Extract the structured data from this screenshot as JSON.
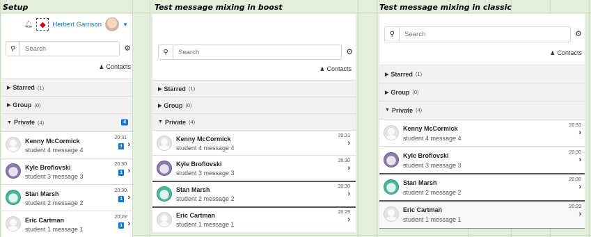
{
  "sections": {
    "setup": "Setup",
    "boost": "Test message mixing in boost",
    "classic": "Test message mixing in classic"
  },
  "user": {
    "name": "Herbert Garrison"
  },
  "search": {
    "placeholder": "Search"
  },
  "contacts_label": "Contacts",
  "groups": {
    "starred": {
      "label": "Starred",
      "count": "(1)"
    },
    "group": {
      "label": "Group",
      "count": "(0)"
    },
    "private": {
      "label": "Private",
      "count": "(4)",
      "unread": "4"
    }
  },
  "contacts": [
    {
      "name": "Kenny McCormick",
      "message": "student 4 message 4",
      "time": "20:31",
      "unread": "1"
    },
    {
      "name": "Kyle Broflovski",
      "message": "student 3 message 3",
      "time": "20:30",
      "unread": "1"
    },
    {
      "name": "Stan Marsh",
      "message": "student 2 message 2",
      "time": "20:30",
      "unread": "1"
    },
    {
      "name": "Eric Cartman",
      "message": "student 1 message 1",
      "time": "20:29",
      "unread": "1"
    }
  ],
  "icons": {
    "bell": "bell-icon",
    "messages": "messages-icon",
    "search": "search-icon",
    "gear": "gear-icon",
    "person": "person-icon",
    "chevron": "chevron-right-icon"
  },
  "colors": {
    "background": "#e2efda",
    "accent": "#1177d1",
    "group_header": "#f2f2f2"
  }
}
